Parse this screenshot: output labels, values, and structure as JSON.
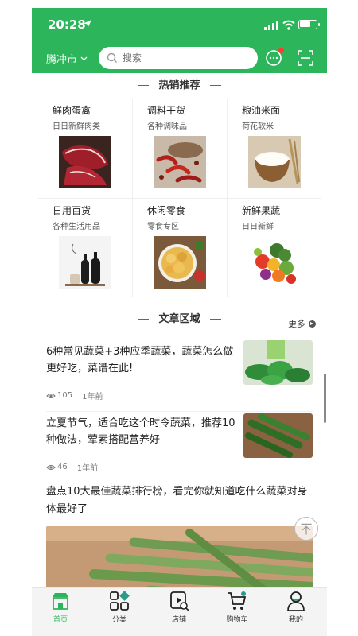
{
  "status_bar": {
    "time": "20:28"
  },
  "header": {
    "city": "腾冲市",
    "search_placeholder": "搜索",
    "brand_color": "#2cb55a"
  },
  "hot_section": {
    "title": "热销推荐"
  },
  "categories": [
    {
      "name": "鲜肉蛋禽",
      "sub": "日日新鲜肉类",
      "image": "raw-meat"
    },
    {
      "name": "调料干货",
      "sub": "各种调味品",
      "image": "dried-chili"
    },
    {
      "name": "粮油米面",
      "sub": "荷花软米",
      "image": "rice-bowl"
    },
    {
      "name": "日用百货",
      "sub": "各种生活用品",
      "image": "bottles"
    },
    {
      "name": "休闲零食",
      "sub": "零食专区",
      "image": "chips-bowl"
    },
    {
      "name": "新鲜果蔬",
      "sub": "日日新鲜",
      "image": "fruits-vegetables"
    }
  ],
  "article_section": {
    "title": "文章区域",
    "more_label": "更多"
  },
  "articles": [
    {
      "title": "6种常见蔬菜+3种应季蔬菜，蔬菜怎么做更好吃，菜谱在此!",
      "views": "105",
      "date": "1年前",
      "image": "green-vegetables"
    },
    {
      "title": "立夏节气，适合吃这个时令蔬菜，推荐10种做法，荤素搭配营养好",
      "views": "46",
      "date": "1年前",
      "image": "cucumbers"
    },
    {
      "title": "盘点10大最佳蔬菜排行榜，看完你就知道吃什么蔬菜对身体最好了",
      "image": "asparagus"
    }
  ],
  "tabbar": [
    {
      "label": "首页",
      "icon": "home-icon",
      "active": true
    },
    {
      "label": "分类",
      "icon": "category-icon",
      "active": false
    },
    {
      "label": "店铺",
      "icon": "shop-icon",
      "active": false
    },
    {
      "label": "购物车",
      "icon": "cart-icon",
      "active": false
    },
    {
      "label": "我的",
      "icon": "profile-icon",
      "active": false
    }
  ]
}
